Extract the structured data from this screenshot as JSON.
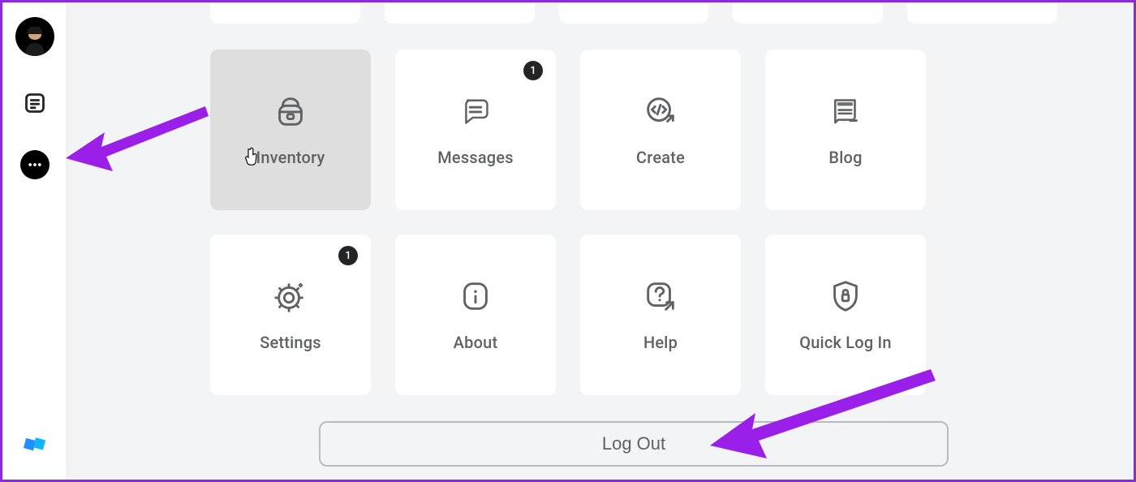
{
  "sidebar": {
    "avatar_alt": "user-avatar",
    "feed_label": "feed",
    "more_label": "more"
  },
  "tiles": [
    {
      "label": "Inventory",
      "badge": null,
      "hover": true
    },
    {
      "label": "Messages",
      "badge": "1",
      "hover": false
    },
    {
      "label": "Create",
      "badge": null,
      "hover": false
    },
    {
      "label": "Blog",
      "badge": null,
      "hover": false
    },
    {
      "label": "Settings",
      "badge": "1",
      "hover": false
    },
    {
      "label": "About",
      "badge": null,
      "hover": false
    },
    {
      "label": "Help",
      "badge": null,
      "hover": false
    },
    {
      "label": "Quick Log In",
      "badge": null,
      "hover": false
    }
  ],
  "logout_label": "Log Out",
  "colors": {
    "accent_annotation": "#9a1fe8",
    "badge_bg": "#232527",
    "tile_hover": "#dedede",
    "text": "#606162"
  }
}
